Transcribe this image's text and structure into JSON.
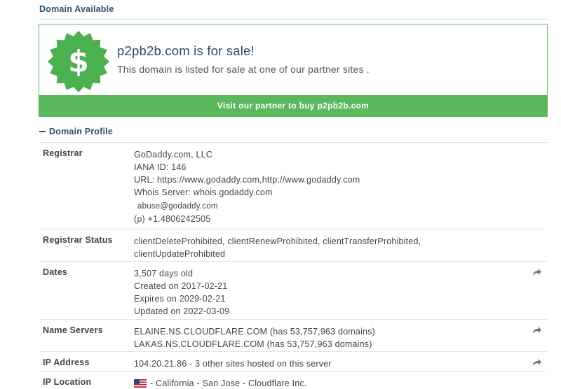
{
  "header": {
    "title": "Domain Available"
  },
  "sale": {
    "title": "p2pb2b.com is for sale!",
    "subtitle": "This domain is listed for sale at one of our partner sites .",
    "button": "Visit our partner to buy p2pb2b.com"
  },
  "profile": {
    "title": "Domain Profile",
    "registrar": {
      "label": "Registrar",
      "name": "GoDaddy.com, LLC",
      "iana": "IANA ID: 146",
      "url": "URL: https://www.godaddy.com,http://www.godaddy.com",
      "whois": "Whois Server: whois.godaddy.com",
      "email": "abuse@godaddy.com",
      "phone": "(p) +1.4806242505"
    },
    "status": {
      "label": "Registrar Status",
      "line1": "clientDeleteProhibited, clientRenewProhibited, clientTransferProhibited,",
      "line2": "clientUpdateProhibited"
    },
    "dates": {
      "label": "Dates",
      "age": "3,507 days old",
      "created": "Created on 2017-02-21",
      "expires": "Expires on 2029-02-21",
      "updated": "Updated on 2022-03-09"
    },
    "nameservers": {
      "label": "Name Servers",
      "ns1": "ELAINE.NS.CLOUDFLARE.COM (has 53,757,963 domains)",
      "ns2": "LAKAS.NS.CLOUDFLARE.COM (has 53,757,963 domains)"
    },
    "ip": {
      "label": "IP Address",
      "value": "104.20.21.86 - 3 other sites hosted on this server"
    },
    "location": {
      "label": "IP Location",
      "value": "- California - San Jose - Cloudflare Inc."
    }
  },
  "icons": {
    "badge": "dollar-badge-icon",
    "share": "share-arrow-icon",
    "flag": "us-flag-icon"
  },
  "colors": {
    "accent_green": "#5cb85c",
    "heading_blue": "#2b5171",
    "badge_green": "#4caf50"
  }
}
